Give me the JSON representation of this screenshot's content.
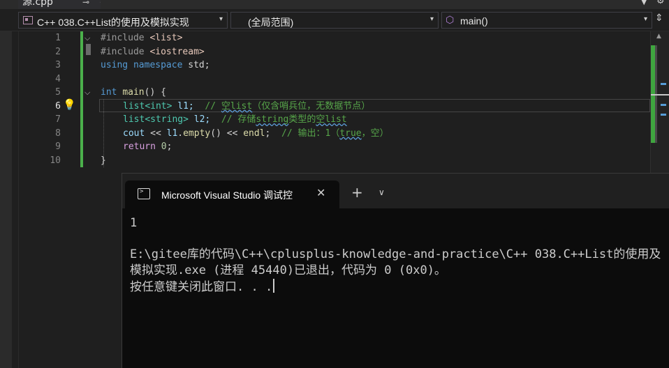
{
  "tab": {
    "file_name": "源.cpp",
    "pin_glyph": "⊸",
    "close_glyph": "✕"
  },
  "nav": {
    "project": "C++ 038.C++List的使用及模拟实现",
    "scope": "(全局范围)",
    "member": "main()"
  },
  "editor": {
    "line_numbers": [
      "1",
      "2",
      "3",
      "4",
      "5",
      "6",
      "7",
      "8",
      "9",
      "10"
    ],
    "current_line": 6,
    "code": {
      "l1_pp": "#include ",
      "l1_hdr": "<list>",
      "l2_pp": "#include ",
      "l2_hdr": "<iostream>",
      "l3_kw1": "using",
      "l3_kw2": "namespace",
      "l3_rest": " std;",
      "l5_type": "int",
      "l5_fn": "main",
      "l5_paren": "()",
      "l5_brace": " {",
      "l6_type": "list",
      "l6_targ": "<int>",
      "l6_var": " l1;",
      "l6_cmt_a": "  // ",
      "l6_cmt_b": "空list",
      "l6_cmt_c": "（仅含哨兵位，无数据节点）",
      "l7_type": "list",
      "l7_targ": "<string>",
      "l7_var": " l2;",
      "l7_cmt_a": "  // 存储",
      "l7_cmt_b": "string",
      "l7_cmt_c": "类型的",
      "l7_cmt_d": "空list",
      "l8_cout": "cout",
      "l8_op1": " << ",
      "l8_obj": "l1",
      "l8_dot": ".",
      "l8_fn": "empty",
      "l8_paren": "()",
      "l8_op2": " << ",
      "l8_endl": "endl",
      "l8_semi": ";",
      "l8_cmt_a": "  // 输出：1（",
      "l8_cmt_b": "true",
      "l8_cmt_c": "，空）",
      "l9_kw": "return",
      "l9_num": " 0",
      "l9_semi": ";",
      "l10": "}"
    }
  },
  "console": {
    "tab_title": "Microsoft Visual Studio 调试控",
    "new_tab_glyph": "+",
    "dropdown_glyph": "⌄",
    "output": [
      "1",
      "",
      "E:\\gitee库的代码\\C++\\cplusplus-knowledge-and-practice\\C++ 038.C++List的使用及",
      "模拟实现.exe (进程 45440)已退出，代码为 0 (0x0)。",
      "按任意键关闭此窗口. . ."
    ]
  }
}
